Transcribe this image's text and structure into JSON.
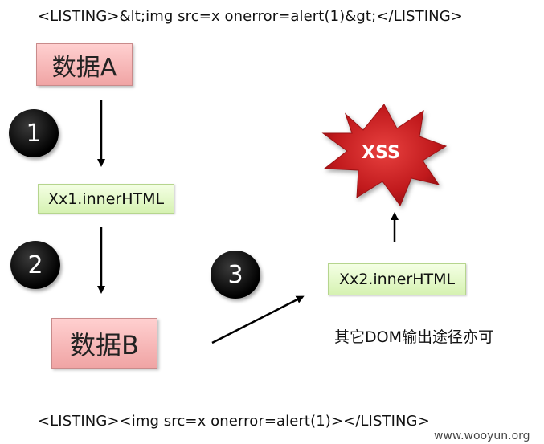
{
  "top_code": "<LISTING>&lt;img src=x onerror=alert(1)&gt;</LISTING>",
  "bottom_code": "<LISTING><img src=x onerror=alert(1)></LISTING>",
  "box_a": "数据A",
  "box_b": "数据B",
  "step1": "Xx1.innerHTML",
  "step2": "Xx2.innerHTML",
  "xss": "XSS",
  "badges": [
    "1",
    "2",
    "3"
  ],
  "note": "其它DOM输出途径亦可",
  "watermark": "www.wooyun.org",
  "colors": {
    "pink_box": "#f0a4a4",
    "green_box": "#d6f2b2",
    "explosion": "#c0191c",
    "badge": "#000000"
  }
}
